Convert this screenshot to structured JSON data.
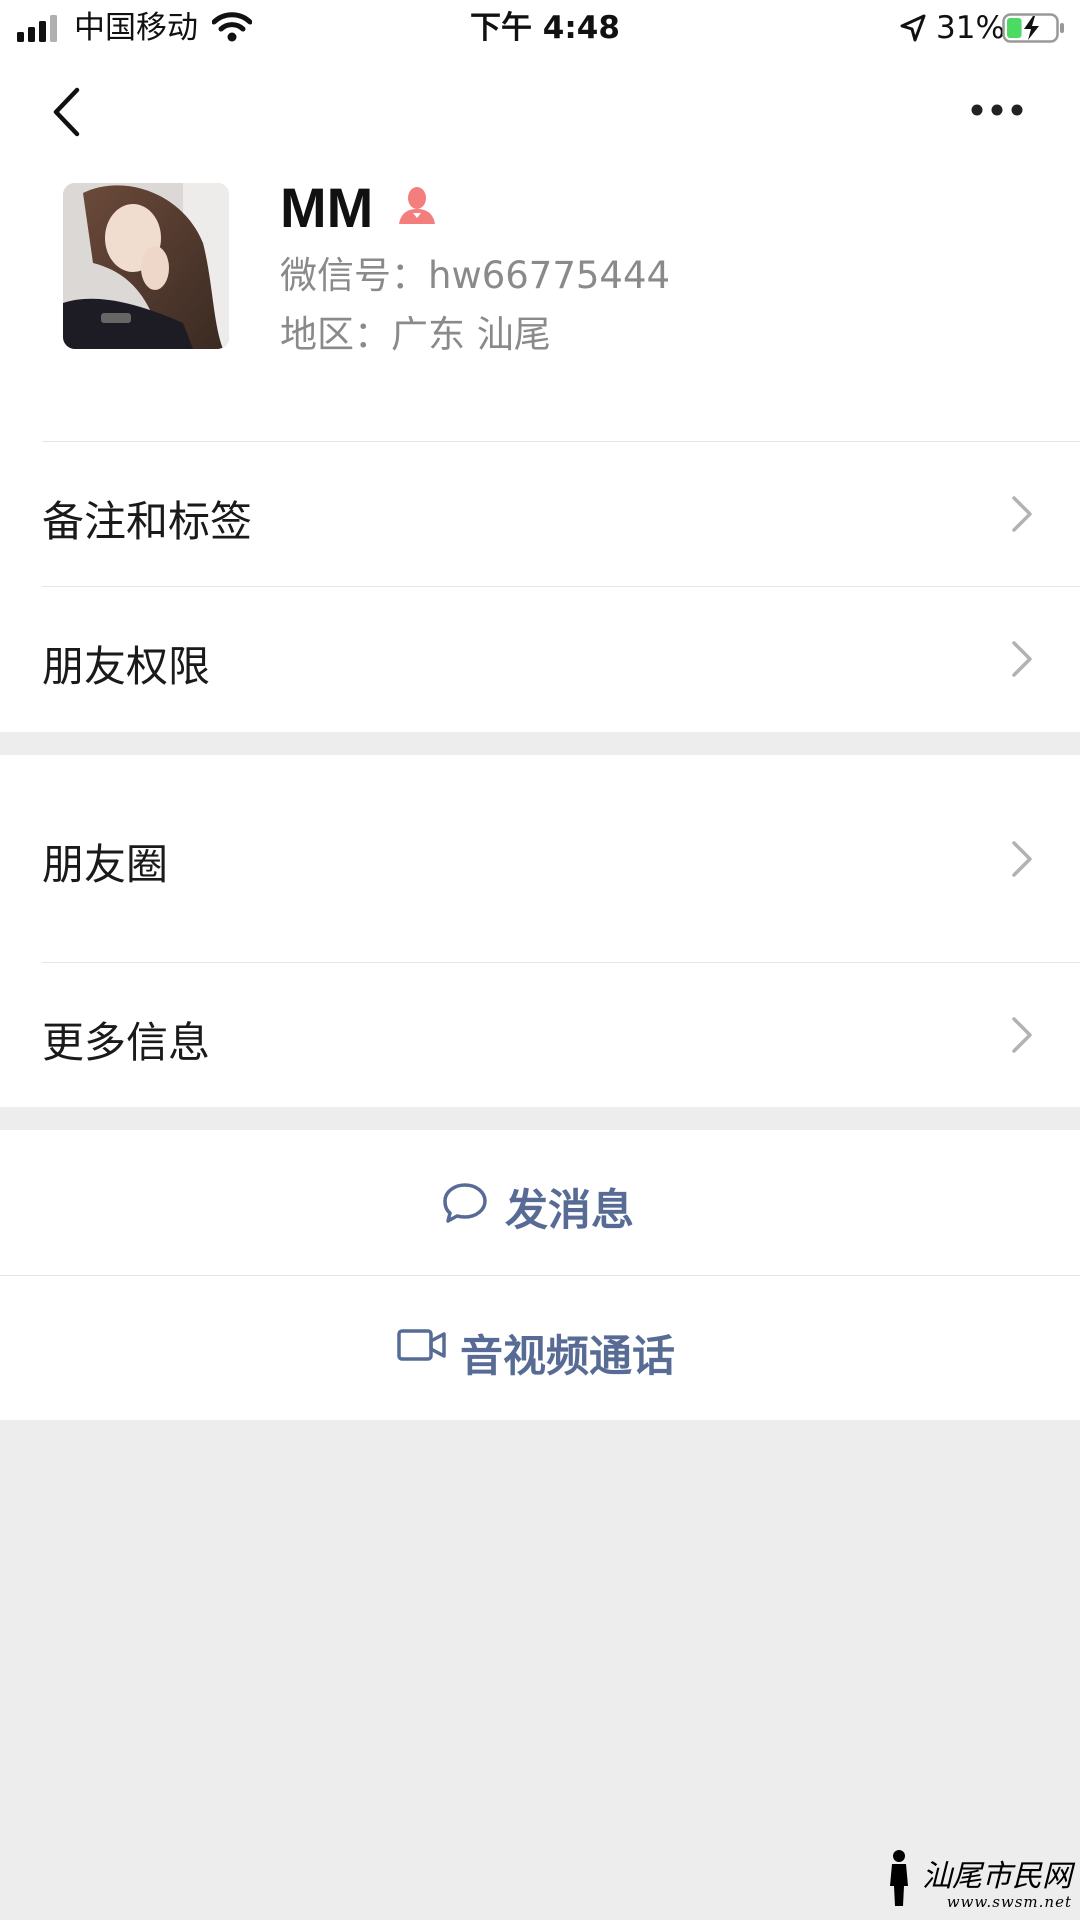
{
  "status_bar": {
    "carrier": "中国移动",
    "time": "下午 4:48",
    "battery": "31%",
    "battery_level": 0.31
  },
  "nav": {
    "back_icon": "chevron-left-icon",
    "more_icon": "more-dots-icon"
  },
  "profile": {
    "name": "MM",
    "gender_icon": "female-icon",
    "wechat_id": "微信号：hw66775444",
    "region": "地区：广东 汕尾"
  },
  "menu": {
    "remarks": "备注和标签",
    "permissions": "朋友权限",
    "moments": "朋友圈",
    "more_info": "更多信息"
  },
  "actions": {
    "send_message": "发消息",
    "video_call": "音视频通话"
  },
  "watermark": {
    "brand": "汕尾市民网",
    "url": "www.swsm.net"
  },
  "colors": {
    "link": "#576b95",
    "gender_female": "#f37e7d",
    "battery_fill": "#4cd964"
  }
}
